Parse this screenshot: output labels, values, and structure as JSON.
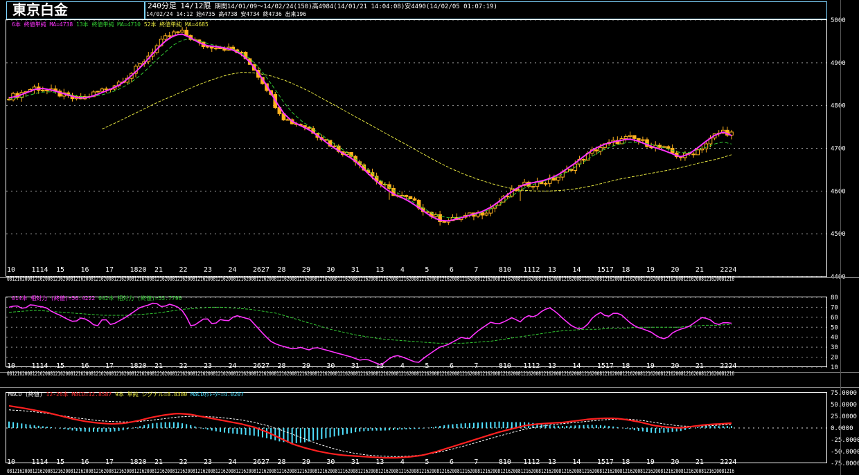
{
  "header": {
    "title": "東京白金",
    "period_type": "240分足",
    "contract": "14/12限",
    "range_info": "期間14/01/09～14/02/24(150)高4984(14/01/21 14:04:08)安4490(14/02/05 01:07:19)",
    "last_bar": "14/02/24 14:12 始4735 高4738 安4734 終4736 出来196"
  },
  "colors": {
    "background": "#000000",
    "candle_body": "#ffb21f",
    "ma6": "#ff33ff",
    "ma13": "#33cc33",
    "ma52": "#e6e640",
    "rsi14": "#ff33ff",
    "rsi42": "#33cc33",
    "macd_line": "#ff2020",
    "signal_line": "#ffffff",
    "oscillator": "#4fe0ff",
    "frame": "#7fd5ff"
  },
  "price_legend": [
    {
      "text": "6本 終値単純 MA=4738",
      "color": "#ff33ff"
    },
    {
      "text": "13本 終値単純 MA=4710",
      "color": "#33cc33"
    },
    {
      "text": "52本 終値単純 MA=4685",
      "color": "#e6e640"
    }
  ],
  "rsi_legend": [
    {
      "text": "014本 相対力 (終値)=56.4222",
      "color": "#ff33ff"
    },
    {
      "text": "042本 相対力 (終値)=53.7796",
      "color": "#33cc33"
    }
  ],
  "macd_legend": [
    {
      "text": "MACD (終値)",
      "color": "#ffffff"
    },
    {
      "text": "12-26本 MACD=12.8587",
      "color": "#ff3030"
    },
    {
      "text": "9本 単純 シグナル=8.8380",
      "color": "#e6e640"
    },
    {
      "text": "MACDｵｼﾚｰﾀｰ=4.0207",
      "color": "#4fe0ff"
    }
  ],
  "date_labels": [
    "10",
    "11",
    "14",
    "15",
    "16",
    "17",
    "18",
    "20",
    "21",
    "22",
    "23",
    "24",
    "27",
    "28",
    "29",
    "30",
    "31",
    "3",
    "4",
    "5",
    "6",
    "7",
    "10",
    "11",
    "12",
    "13",
    "14",
    "17",
    "18",
    "19",
    "20",
    "21",
    "24"
  ],
  "date_labels_display": [
    "10",
    "1114",
    "15",
    "16",
    "17",
    "1820",
    "21",
    "22",
    "23",
    "24",
    "2627",
    "28",
    "29",
    "30",
    "31",
    "13",
    "4",
    "5",
    "6",
    "7",
    "810",
    "1112",
    "13",
    "14",
    "1517",
    "18",
    "19",
    "20",
    "21",
    "2224"
  ],
  "time_strip": "0812162008121620081216200812162008121620081216200812162008121620081216200812162008121620081216200812162008121620081216200812162008121620081216200812162008121620081216200812162008121620081216200812162008121620081216200812162008121620081216200812162008121620081216200812162008121620081216",
  "chart_data": [
    {
      "type": "candlestick",
      "ylim": [
        4400,
        5000
      ],
      "yticks": [
        "5000",
        "4900",
        "4800",
        "4700",
        "4600",
        "4500",
        "4400"
      ],
      "close_path": [
        4820,
        4825,
        4835,
        4842,
        4838,
        4832,
        4826,
        4818,
        4815,
        4820,
        4830,
        4838,
        4845,
        4858,
        4872,
        4890,
        4912,
        4935,
        4955,
        4968,
        4972,
        4960,
        4945,
        4938,
        4940,
        4935,
        4930,
        4920,
        4900,
        4870,
        4840,
        4800,
        4770,
        4760,
        4755,
        4745,
        4730,
        4715,
        4700,
        4690,
        4680,
        4660,
        4640,
        4620,
        4605,
        4590,
        4585,
        4575,
        4560,
        4545,
        4535,
        4530,
        4535,
        4540,
        4545,
        4550,
        4560,
        4575,
        4590,
        4605,
        4615,
        4618,
        4620,
        4625,
        4635,
        4650,
        4665,
        4680,
        4695,
        4705,
        4712,
        4718,
        4725,
        4720,
        4712,
        4705,
        4700,
        4690,
        4680,
        4685,
        4695,
        4710,
        4730,
        4740,
        4735
      ],
      "ma6_path": [
        4818,
        4822,
        4830,
        4838,
        4840,
        4836,
        4830,
        4824,
        4818,
        4818,
        4824,
        4832,
        4840,
        4850,
        4866,
        4884,
        4905,
        4928,
        4948,
        4962,
        4968,
        4960,
        4948,
        4940,
        4938,
        4935,
        4930,
        4920,
        4902,
        4876,
        4846,
        4810,
        4780,
        4762,
        4752,
        4742,
        4728,
        4712,
        4698,
        4686,
        4674,
        4656,
        4636,
        4618,
        4602,
        4590,
        4582,
        4570,
        4556,
        4542,
        4532,
        4530,
        4534,
        4540,
        4546,
        4552,
        4562,
        4576,
        4592,
        4606,
        4616,
        4620,
        4624,
        4630,
        4640,
        4654,
        4668,
        4684,
        4698,
        4708,
        4714,
        4718,
        4722,
        4718,
        4710,
        4702,
        4696,
        4688,
        4680,
        4686,
        4700,
        4716,
        4730,
        4738,
        4730
      ],
      "ma13_path": [
        4815,
        4818,
        4822,
        4828,
        4832,
        4832,
        4830,
        4826,
        4822,
        4820,
        4822,
        4826,
        4832,
        4840,
        4852,
        4866,
        4884,
        4904,
        4922,
        4940,
        4952,
        4956,
        4952,
        4946,
        4940,
        4936,
        4932,
        4924,
        4910,
        4890,
        4864,
        4836,
        4806,
        4782,
        4764,
        4750,
        4736,
        4722,
        4708,
        4694,
        4680,
        4664,
        4646,
        4628,
        4612,
        4598,
        4586,
        4574,
        4562,
        4550,
        4542,
        4538,
        4538,
        4540,
        4544,
        4550,
        4558,
        4568,
        4582,
        4596,
        4608,
        4616,
        4622,
        4628,
        4636,
        4646,
        4658,
        4670,
        4684,
        4696,
        4704,
        4710,
        4714,
        4714,
        4712,
        4708,
        4702,
        4696,
        4690,
        4690,
        4696,
        4702,
        4710,
        4715,
        4710
      ],
      "ma52_path": [
        4745,
        4760,
        4776,
        4792,
        4808,
        4822,
        4836,
        4850,
        4862,
        4872,
        4878,
        4876,
        4870,
        4860,
        4846,
        4830,
        4812,
        4794,
        4776,
        4758,
        4740,
        4722,
        4704,
        4686,
        4668,
        4652,
        4638,
        4626,
        4616,
        4608,
        4602,
        4600,
        4600,
        4602,
        4606,
        4612,
        4620,
        4628,
        4634,
        4640,
        4646,
        4652,
        4660,
        4668,
        4675,
        4685
      ]
    },
    {
      "type": "line",
      "ylim": [
        10,
        80
      ],
      "yticks": [
        "80",
        "70",
        "60",
        "50",
        "40",
        "30",
        "20",
        "10"
      ],
      "rsi14_path": [
        70,
        72,
        68,
        73,
        71,
        70,
        65,
        62,
        58,
        55,
        60,
        56,
        50,
        60,
        52,
        56,
        60,
        65,
        70,
        72,
        75,
        70,
        73,
        71,
        65,
        50,
        55,
        60,
        52,
        58,
        56,
        62,
        60,
        58,
        50,
        42,
        35,
        32,
        30,
        28,
        30,
        27,
        30,
        28,
        26,
        24,
        22,
        20,
        17,
        18,
        15,
        12,
        18,
        22,
        20,
        17,
        14,
        20,
        25,
        30,
        32,
        36,
        40,
        38,
        45,
        50,
        55,
        53,
        56,
        60,
        55,
        62,
        60,
        66,
        70,
        65,
        58,
        52,
        48,
        50,
        60,
        65,
        60,
        65,
        62,
        55,
        50,
        48,
        45,
        40,
        38,
        45,
        48,
        50,
        55,
        60,
        58,
        52,
        55,
        54
      ],
      "rsi42_path": [
        65,
        66,
        67,
        66,
        65,
        64,
        63,
        62,
        62,
        62,
        63,
        64,
        66,
        68,
        69,
        70,
        70,
        69,
        68,
        66,
        64,
        60,
        56,
        52,
        48,
        45,
        42,
        40,
        38,
        37,
        36,
        35,
        34,
        34,
        34,
        35,
        36,
        38,
        40,
        42,
        44,
        46,
        47,
        48,
        48,
        49,
        49,
        50,
        50,
        50,
        50,
        51,
        52,
        52,
        53
      ]
    },
    {
      "type": "macd",
      "ylim": [
        -87.5,
        87.5
      ],
      "yticks": [
        "75.0000",
        "50.0000",
        "25.0000",
        "0.0000",
        "-25.0000",
        "-50.0000",
        "-75.0000"
      ],
      "macd_path": [
        55,
        50,
        44,
        38,
        30,
        22,
        16,
        12,
        10,
        12,
        18,
        26,
        32,
        36,
        34,
        28,
        22,
        16,
        10,
        2,
        -10,
        -25,
        -40,
        -50,
        -58,
        -64,
        -68,
        -70,
        -72,
        -74,
        -74,
        -72,
        -68,
        -60,
        -50,
        -40,
        -30,
        -20,
        -10,
        -2,
        6,
        10,
        12,
        14,
        18,
        22,
        24,
        24,
        20,
        14,
        6,
        2,
        0,
        4,
        8,
        10,
        12
      ],
      "signal_path": [
        45,
        43,
        40,
        36,
        31,
        26,
        22,
        18,
        16,
        15,
        16,
        19,
        23,
        27,
        29,
        29,
        27,
        24,
        20,
        14,
        6,
        -4,
        -16,
        -28,
        -40,
        -50,
        -58,
        -64,
        -68,
        -70,
        -71,
        -70,
        -67,
        -62,
        -55,
        -47,
        -38,
        -29,
        -20,
        -11,
        -3,
        3,
        8,
        11,
        14,
        17,
        20,
        22,
        22,
        19,
        14,
        9,
        5,
        4,
        5,
        7,
        9
      ]
    }
  ]
}
